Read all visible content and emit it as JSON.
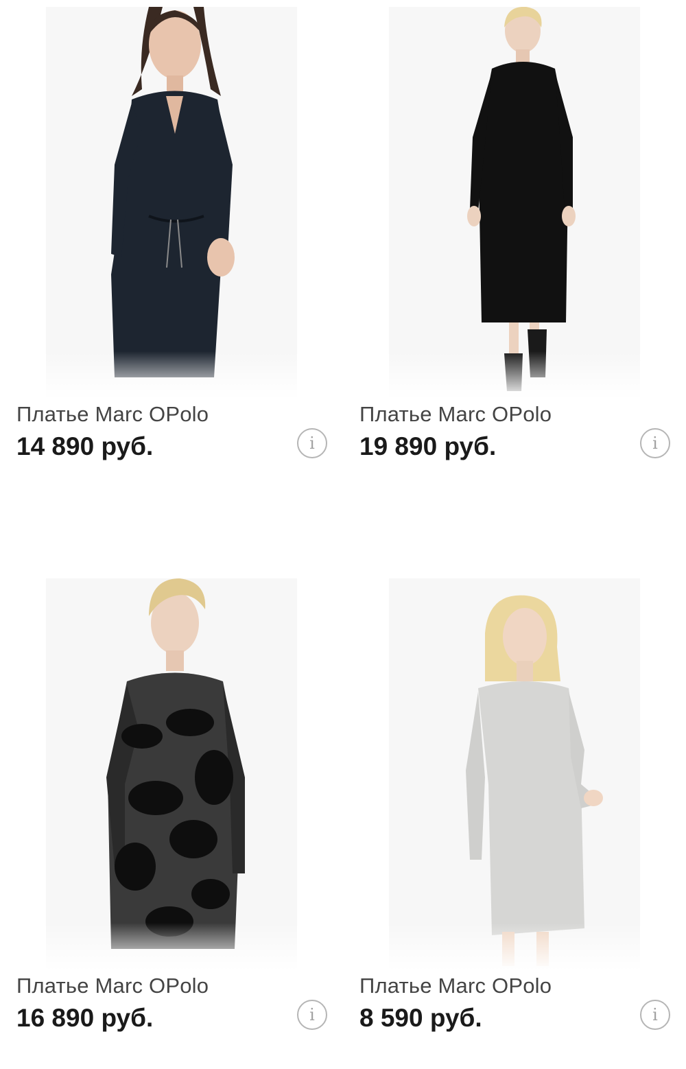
{
  "products": [
    {
      "title": "Платье Marc OPolo",
      "price": "14 890 руб.",
      "image": "woman-dark-navy-shirt-dress",
      "dress_color": "#1d2530",
      "info_icon": "info-icon"
    },
    {
      "title": "Платье Marc OPolo",
      "price": "19 890 руб.",
      "image": "woman-black-knit-maxi-dress",
      "dress_color": "#111111",
      "info_icon": "info-icon"
    },
    {
      "title": "Платье Marc OPolo",
      "price": "16 890 руб.",
      "image": "woman-black-grey-floral-dress",
      "dress_color": "#3a3a3a",
      "info_icon": "info-icon"
    },
    {
      "title": "Платье Marc OPolo",
      "price": "8 590 руб.",
      "image": "woman-light-grey-sweater-dress",
      "dress_color": "#d6d6d4",
      "info_icon": "info-icon"
    }
  ],
  "colors": {
    "price": "#1a1a1a",
    "title": "#444444",
    "info_border": "#b5b5b5"
  }
}
